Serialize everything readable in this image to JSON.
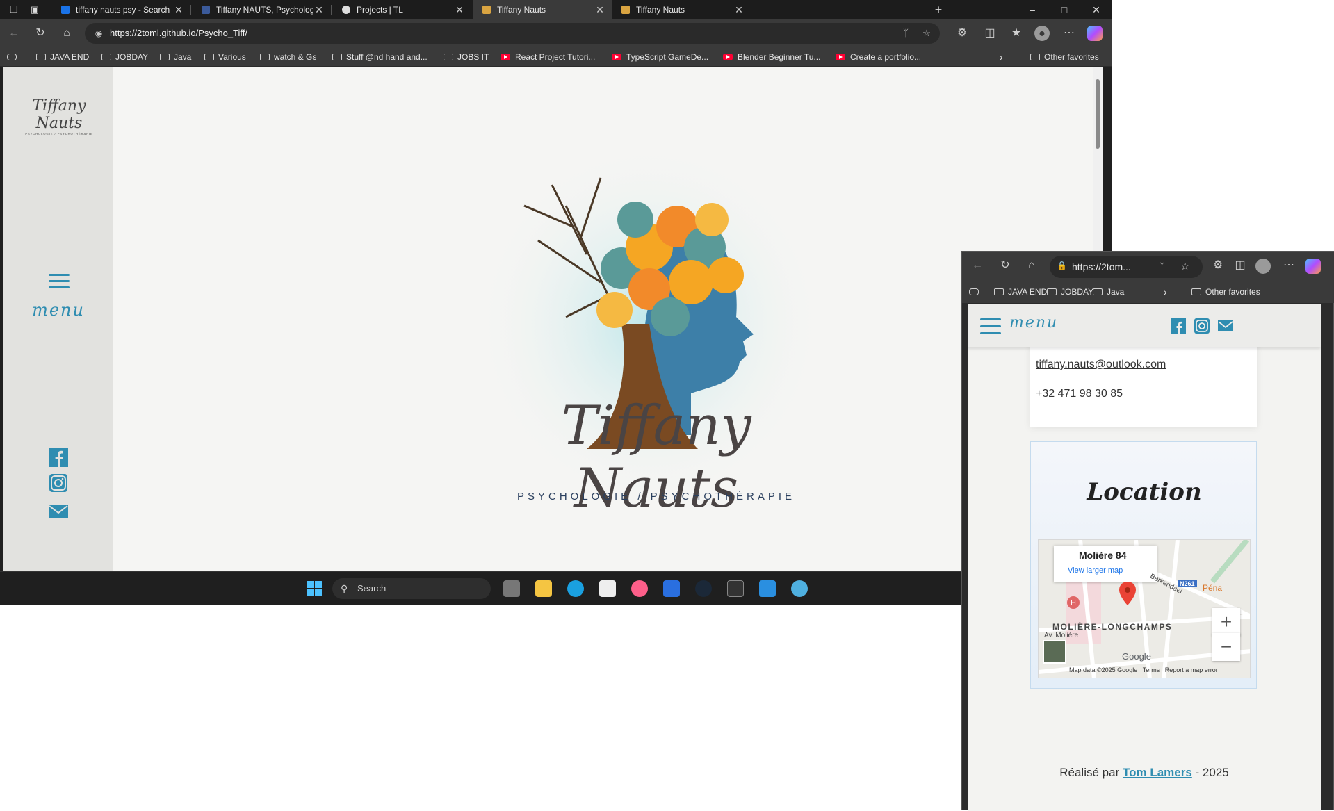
{
  "main_browser": {
    "tabs": [
      {
        "title": "tiffany nauts psy - Search",
        "favicon_color": "#1a73e8"
      },
      {
        "title": "Tiffany NAUTS, Psychologue clinic",
        "favicon_color": "#3b5a9a"
      },
      {
        "title": "Projects | TL",
        "favicon_color": "#dddddd"
      },
      {
        "title": "Tiffany Nauts",
        "favicon_color": "#d9a441"
      },
      {
        "title": "Tiffany Nauts",
        "favicon_color": "#d9a441"
      }
    ],
    "active_tab_index": 3,
    "url": "https://2toml.github.io/Psycho_Tiff/",
    "bookmarks": [
      {
        "label": "JAVA END",
        "type": "folder"
      },
      {
        "label": "JOBDAY",
        "type": "folder"
      },
      {
        "label": "Java",
        "type": "folder"
      },
      {
        "label": "Various",
        "type": "folder"
      },
      {
        "label": "watch & Gs",
        "type": "folder"
      },
      {
        "label": "Stuff @nd hand and...",
        "type": "folder"
      },
      {
        "label": "JOBS IT",
        "type": "folder"
      },
      {
        "label": "React Project Tutori...",
        "type": "youtube"
      },
      {
        "label": "TypeScript GameDe...",
        "type": "youtube"
      },
      {
        "label": "Blender Beginner Tu...",
        "type": "youtube"
      },
      {
        "label": "Create a portfolio...",
        "type": "youtube"
      }
    ],
    "other_favorites": "Other favorites"
  },
  "site": {
    "sidebar_logo_name": "Tiffany Nauts",
    "sidebar_logo_sub": "PSYCHOLOGIE / PSYCHOTHÉRAPIE",
    "menu_label": "menu",
    "hero_name": "Tiffany Nauts",
    "hero_subtitle": "PSYCHOLOGIE / PSYCHOTHÉRAPIE",
    "brand_color": "#2f8db1"
  },
  "taskbar": {
    "search_placeholder": "Search"
  },
  "small_browser": {
    "url": "https://2tom...",
    "bookmarks": [
      "JAVA END",
      "JOBDAY",
      "Java"
    ],
    "other_favorites": "Other favorites",
    "menu_label": "menu",
    "email": "tiffany.nauts@outlook.com",
    "phone": "+32 471 98 30 85",
    "location_title": "Location",
    "map": {
      "place_name": "Molière 84",
      "larger_map_link": "View larger map",
      "area_label": "MOLIÈRE-LONGCHAMPS",
      "street_label": "Av. Molière",
      "berkendael_label": "Berkendael",
      "road_label": "N261",
      "pena_label": "Péna",
      "google_label": "Google",
      "attribution": "Map data ©2025 Google",
      "terms": "Terms",
      "report": "Report a map error",
      "zoom_in": "+",
      "zoom_out": "−"
    },
    "footer_prefix": "Réalisé par",
    "footer_author": "Tom Lamers",
    "footer_suffix": "- 2025"
  }
}
